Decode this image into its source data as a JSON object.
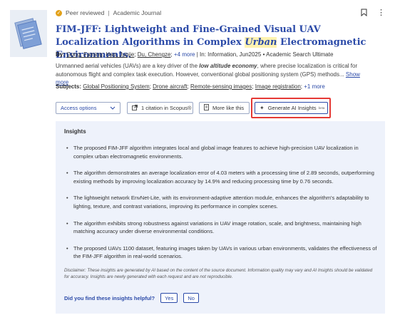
{
  "record": {
    "peer_reviewed": "Peer reviewed",
    "source_type": "Academic Journal",
    "title_part1": "FIM-JFF: Lightweight and Fine-Grained Visual UAV Localization Algorithms in Complex ",
    "title_highlight": "Urban",
    "title_part2": " Electromagnetic Environments.",
    "by_label": "By:",
    "authors": [
      "Gong, Faming",
      "Hao, Junjie",
      "Du, Chengze"
    ],
    "more_authors": "+4 more",
    "in_source": "In: Information, Jun2025",
    "database": "Academic Search Ultimate",
    "abstract_pre": "Unmanned aerial vehicles (UAVs) are a key driver of the ",
    "abstract_bold": "low altitude economy",
    "abstract_post": ", where precise localization is critical for autonomous flight and complex task execution. However, conventional global positioning system (GPS) methods...",
    "show_more": "Show more",
    "subjects_label": "Subjects:",
    "subjects": [
      "Global Positioning System",
      "Drone aircraft",
      "Remote-sensing images",
      "Image registration"
    ],
    "more_subjects": "+1 more"
  },
  "actions": {
    "access_options": "Access options",
    "citation": "1 citation in Scopus®",
    "more_like_this": "More like this",
    "ai_insights": "Generate AI Insights",
    "beta": "beta"
  },
  "insights": {
    "title": "Insights",
    "items": [
      "The proposed FIM-JFF algorithm integrates local and global image features to achieve high-precision UAV localization in complex urban electromagnetic environments.",
      "The algorithm demonstrates an average localization error of 4.03 meters with a processing time of 2.89 seconds, outperforming existing methods by improving localization accuracy by 14.9% and reducing processing time by 0.76 seconds.",
      "The lightweight network EnvNet-Lite, with its environment-adaptive attention module, enhances the algorithm's adaptability to lighting, texture, and contrast variations, improving its performance in complex scenes.",
      "The algorithm exhibits strong robustness against variations in UAV image rotation, scale, and brightness, maintaining high matching accuracy under diverse environmental conditions.",
      "The proposed UAVs 1100 dataset, featuring images taken by UAVs in various urban environments, validates the effectiveness of the FIM-JFF algorithm in real-world scenarios."
    ],
    "disclaimer": "Disclaimer: These insights are generated by AI based on the content of the source document. Information quality may vary and AI Insights should be validated for accuracy. Insights are newly generated with each request and are not reproducible.",
    "helpful_question": "Did you find these insights helpful?",
    "yes": "Yes",
    "no": "No"
  },
  "colors": {
    "title": "#2b4aa8",
    "highlight": "#fff3b0",
    "panel_bg": "#eef2fb",
    "peer_reviewed_badge": "#e2a11a",
    "highlight_box": "#e53935"
  },
  "icons": {
    "peer_reviewed": "check-badge-icon",
    "bookmark": "bookmark-icon",
    "more": "more-vertical-icon",
    "access_dropdown": "chevron-down-icon",
    "citation": "external-link-icon",
    "more_like_this": "document-icon",
    "ai": "sparkle-icon"
  }
}
